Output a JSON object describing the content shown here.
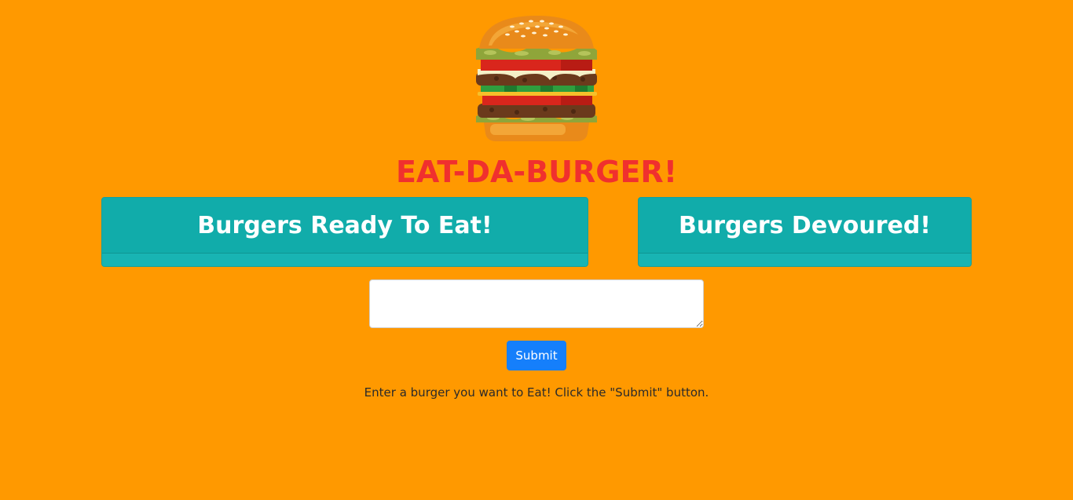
{
  "header": {
    "logo_icon": "burger-icon",
    "title": "EAT-DA-BURGER!",
    "title_color": "#F0302E"
  },
  "columns": {
    "ready": {
      "label": "Burgers Ready To Eat!"
    },
    "devoured": {
      "label": "Burgers Devoured!"
    }
  },
  "form": {
    "burger_value": "",
    "submit_label": "Submit",
    "instructions": "Enter a burger you want to Eat! Click the \"Submit\" button."
  },
  "colors": {
    "background": "#FF9900",
    "card_header": "#11ACAA",
    "button": "#157FFB"
  }
}
